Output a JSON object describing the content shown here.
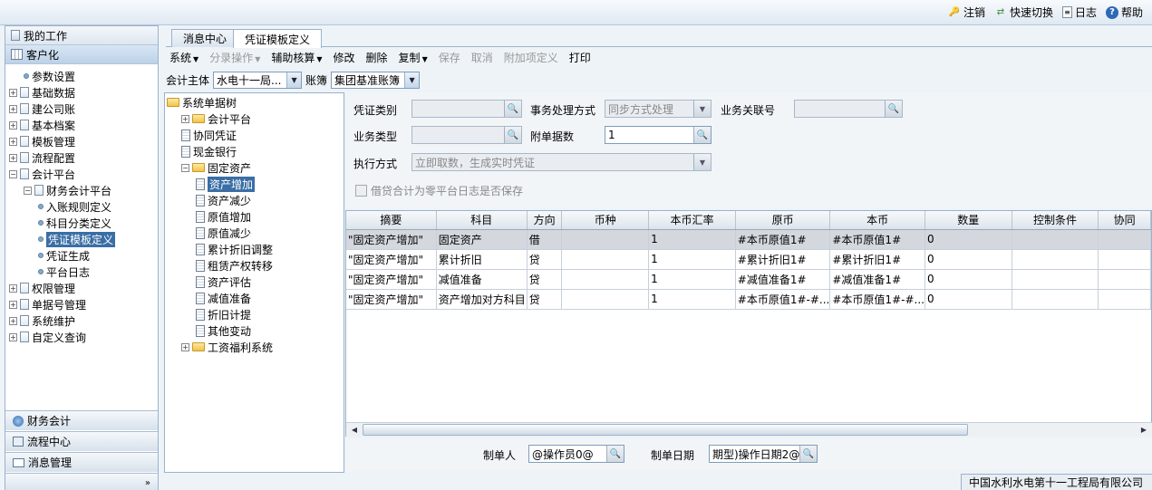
{
  "topbar": {
    "logout": "注销",
    "quick_switch": "快速切换",
    "log": "日志",
    "help": "帮助"
  },
  "nav": {
    "my_work": "我的工作",
    "customize": "客户化",
    "tree": [
      {
        "label": "参数设置",
        "level": 1,
        "kind": "leaf"
      },
      {
        "label": "基础数据",
        "level": 0,
        "kind": "group"
      },
      {
        "label": "建公司账",
        "level": 0,
        "kind": "group"
      },
      {
        "label": "基本档案",
        "level": 0,
        "kind": "group"
      },
      {
        "label": "模板管理",
        "level": 0,
        "kind": "group"
      },
      {
        "label": "流程配置",
        "level": 0,
        "kind": "group"
      },
      {
        "label": "会计平台",
        "level": 0,
        "kind": "group-open"
      },
      {
        "label": "财务会计平台",
        "level": 1,
        "kind": "group-open"
      },
      {
        "label": "入账规则定义",
        "level": 2,
        "kind": "leaf"
      },
      {
        "label": "科目分类定义",
        "level": 2,
        "kind": "leaf"
      },
      {
        "label": "凭证模板定义",
        "level": 2,
        "kind": "leaf",
        "selected": true
      },
      {
        "label": "凭证生成",
        "level": 2,
        "kind": "leaf"
      },
      {
        "label": "平台日志",
        "level": 2,
        "kind": "leaf"
      },
      {
        "label": "权限管理",
        "level": 0,
        "kind": "group"
      },
      {
        "label": "单据号管理",
        "level": 0,
        "kind": "group"
      },
      {
        "label": "系统维护",
        "level": 0,
        "kind": "group"
      },
      {
        "label": "自定义查询",
        "level": 0,
        "kind": "group"
      }
    ],
    "bottom": [
      "财务会计",
      "流程中心",
      "消息管理"
    ]
  },
  "tabs": [
    "消息中心",
    "凭证模板定义"
  ],
  "toolbar": [
    {
      "label": "系统",
      "caret": true,
      "enabled": true
    },
    {
      "label": "分录操作",
      "caret": true,
      "enabled": false
    },
    {
      "label": "辅助核算",
      "caret": true,
      "enabled": true
    },
    {
      "label": "修改",
      "caret": false,
      "enabled": true
    },
    {
      "label": "删除",
      "caret": false,
      "enabled": true
    },
    {
      "label": "复制",
      "caret": true,
      "enabled": true
    },
    {
      "label": "保存",
      "caret": false,
      "enabled": false
    },
    {
      "label": "取消",
      "caret": false,
      "enabled": false
    },
    {
      "label": "附加项定义",
      "caret": false,
      "enabled": false
    },
    {
      "label": "打印",
      "caret": false,
      "enabled": true
    }
  ],
  "subject": {
    "entity_label": "会计主体",
    "entity_value": "水电十一局...",
    "book_label": "账簿",
    "book_value": "集团基准账簿"
  },
  "doc_tree": [
    {
      "label": "系统单据树",
      "level": 0,
      "kind": "root"
    },
    {
      "label": "会计平台",
      "level": 1,
      "kind": "folder-closed"
    },
    {
      "label": "协同凭证",
      "level": 1,
      "kind": "sheet"
    },
    {
      "label": "现金银行",
      "level": 1,
      "kind": "sheet"
    },
    {
      "label": "固定资产",
      "level": 1,
      "kind": "folder-open"
    },
    {
      "label": "资产增加",
      "level": 2,
      "kind": "sheet",
      "selected": true
    },
    {
      "label": "资产减少",
      "level": 2,
      "kind": "sheet"
    },
    {
      "label": "原值增加",
      "level": 2,
      "kind": "sheet"
    },
    {
      "label": "原值减少",
      "level": 2,
      "kind": "sheet"
    },
    {
      "label": "累计折旧调整",
      "level": 2,
      "kind": "sheet"
    },
    {
      "label": "租赁产权转移",
      "level": 2,
      "kind": "sheet"
    },
    {
      "label": "资产评估",
      "level": 2,
      "kind": "sheet"
    },
    {
      "label": "减值准备",
      "level": 2,
      "kind": "sheet"
    },
    {
      "label": "折旧计提",
      "level": 2,
      "kind": "sheet"
    },
    {
      "label": "其他变动",
      "level": 2,
      "kind": "sheet"
    },
    {
      "label": "工资福利系统",
      "level": 1,
      "kind": "folder-closed"
    }
  ],
  "form": {
    "voucher_type_label": "凭证类别",
    "voucher_type_value": "",
    "process_label": "事务处理方式",
    "process_value": "同步方式处理",
    "biz_keyword_label": "业务关联号",
    "biz_keyword_value": "",
    "biz_type_label": "业务类型",
    "biz_type_value": "",
    "attach_label": "附单据数",
    "attach_value": "1",
    "exec_label": "执行方式",
    "exec_value": "立即取数，生成实时凭证",
    "zero_check_label": "借贷合计为零平台日志是否保存"
  },
  "grid": {
    "columns": [
      "摘要",
      "科目",
      "方向",
      "币种",
      "本币汇率",
      "原币",
      "本币",
      "数量",
      "控制条件",
      "协同"
    ],
    "rows": [
      [
        "\"固定资产增加\"",
        "固定资产",
        "借",
        "",
        "1",
        "#本币原值1#",
        "#本币原值1#",
        "0",
        "",
        ""
      ],
      [
        "\"固定资产增加\"",
        "累计折旧",
        "贷",
        "",
        "1",
        "#累计折旧1#",
        "#累计折旧1#",
        "0",
        "",
        ""
      ],
      [
        "\"固定资产增加\"",
        "减值准备",
        "贷",
        "",
        "1",
        "#减值准备1#",
        "#减值准备1#",
        "0",
        "",
        ""
      ],
      [
        "\"固定资产增加\"",
        "资产增加对方科目",
        "贷",
        "",
        "1",
        "#本币原值1#-#...",
        "#本币原值1#-#...",
        "0",
        "",
        ""
      ]
    ]
  },
  "footer": {
    "maker_label": "制单人",
    "maker_value": "@操作员0@",
    "date_label": "制单日期",
    "date_value": "期型)操作日期2@"
  },
  "status": "中国水利水电第十一工程局有限公司",
  "colors": {
    "accent": "#3a6ea5",
    "border": "#99b3cc"
  }
}
